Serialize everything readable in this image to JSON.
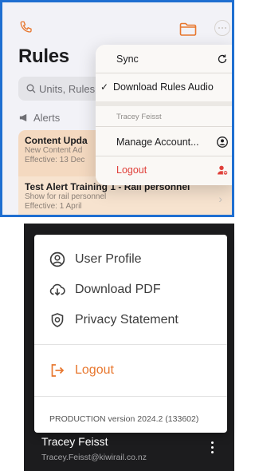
{
  "colors": {
    "brand_orange": "#e8772e",
    "ios_red": "#e0403a",
    "highlight_border": "#1f6fd1"
  },
  "top": {
    "title": "Rules",
    "search_placeholder": "Units, Rules,",
    "alerts_label": "Alerts",
    "alerts": [
      {
        "title": "Content Upda",
        "line1": "New Content Ad",
        "line2": "Effective: 13 Dec"
      },
      {
        "title_prefix": "Test Alert Training",
        "title_bold": "1 - Rail personnel",
        "line1": "Show for rail personnel",
        "line2": "Effective: 1 April"
      }
    ]
  },
  "ios_menu": {
    "sync": "Sync",
    "download_audio": "Download Rules Audio",
    "account_name": "Tracey Feisst",
    "manage_account": "Manage Account...",
    "logout": "Logout"
  },
  "web_menu": {
    "user_profile": "User Profile",
    "download_pdf": "Download PDF",
    "privacy_statement": "Privacy Statement",
    "logout": "Logout",
    "version": "PRODUCTION version 2024.2 (133602)"
  },
  "user": {
    "name": "Tracey Feisst",
    "email": "Tracey.Feisst@kiwirail.co.nz"
  }
}
